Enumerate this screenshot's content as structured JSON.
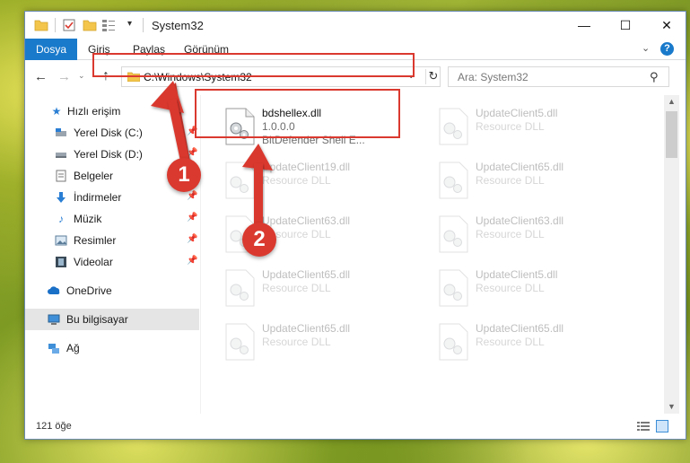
{
  "window": {
    "title": "System32",
    "controls": {
      "minimize": "—",
      "maximize": "☐",
      "close": "✕"
    }
  },
  "quick_access_toolbar": {
    "dropdown_glyph": "▾",
    "icons": [
      "folder-icon",
      "properties-icon",
      "new-folder-icon",
      "view-icon"
    ]
  },
  "ribbon": {
    "tabs": [
      "Dosya",
      "Giriş",
      "Paylaş",
      "Görünüm"
    ],
    "expand_glyph": "⌄",
    "help_glyph": "?"
  },
  "navigation": {
    "back_glyph": "←",
    "forward_glyph": "→",
    "recent_glyph": "⌄",
    "up_glyph": "↑",
    "address": "C:\\Windows\\System32",
    "address_drop_glyph": "⌄",
    "refresh_glyph": "↻",
    "search_placeholder": "Ara: System32",
    "search_glyph": "⚲"
  },
  "sidebar": {
    "items": [
      {
        "label": "Hızlı erişim",
        "icon": "star-icon",
        "pinned": false
      },
      {
        "label": "Yerel Disk (C:)",
        "icon": "drive-icon",
        "pinned": true
      },
      {
        "label": "Yerel Disk (D:)",
        "icon": "drive-icon",
        "pinned": true
      },
      {
        "label": "Belgeler",
        "icon": "documents-icon",
        "pinned": true
      },
      {
        "label": "İndirmeler",
        "icon": "downloads-icon",
        "pinned": true
      },
      {
        "label": "Müzik",
        "icon": "music-icon",
        "pinned": true
      },
      {
        "label": "Resimler",
        "icon": "pictures-icon",
        "pinned": true
      },
      {
        "label": "Videolar",
        "icon": "videos-icon",
        "pinned": true
      },
      {
        "label": "OneDrive",
        "icon": "onedrive-icon",
        "pinned": false
      },
      {
        "label": "Bu bilgisayar",
        "icon": "computer-icon",
        "pinned": false,
        "selected": true
      },
      {
        "label": "Ağ",
        "icon": "network-icon",
        "pinned": false
      }
    ]
  },
  "files": [
    {
      "name": "bdshellex.dll",
      "line1": "1.0.0.0",
      "line2": "BitDefender Shell E...",
      "highlighted": true
    },
    {
      "name": "UpdateClient5.dll",
      "line1": "Resource DLL",
      "line2": ""
    },
    {
      "name": "UpdateClient19.dll",
      "line1": "Resource DLL",
      "line2": ""
    },
    {
      "name": "UpdateClient65.dll",
      "line1": "Resource DLL",
      "line2": ""
    },
    {
      "name": "UpdateClient63.dll",
      "line1": "Resource DLL",
      "line2": ""
    },
    {
      "name": "UpdateClient63.dll",
      "line1": "Resource DLL",
      "line2": ""
    },
    {
      "name": "UpdateClient65.dll",
      "line1": "Resource DLL",
      "line2": ""
    },
    {
      "name": "UpdateClient5.dll",
      "line1": "Resource DLL",
      "line2": ""
    },
    {
      "name": "UpdateClient65.dll",
      "line1": "Resource DLL",
      "line2": ""
    },
    {
      "name": "UpdateClient65.dll",
      "line1": "Resource DLL",
      "line2": ""
    }
  ],
  "status": {
    "item_count": "121 öğe"
  },
  "annotations": {
    "step1": "1",
    "step2": "2",
    "color": "#d9392f"
  },
  "colors": {
    "ribbon_file_tab": "#1979ca",
    "selection": "#e5e5e5"
  }
}
